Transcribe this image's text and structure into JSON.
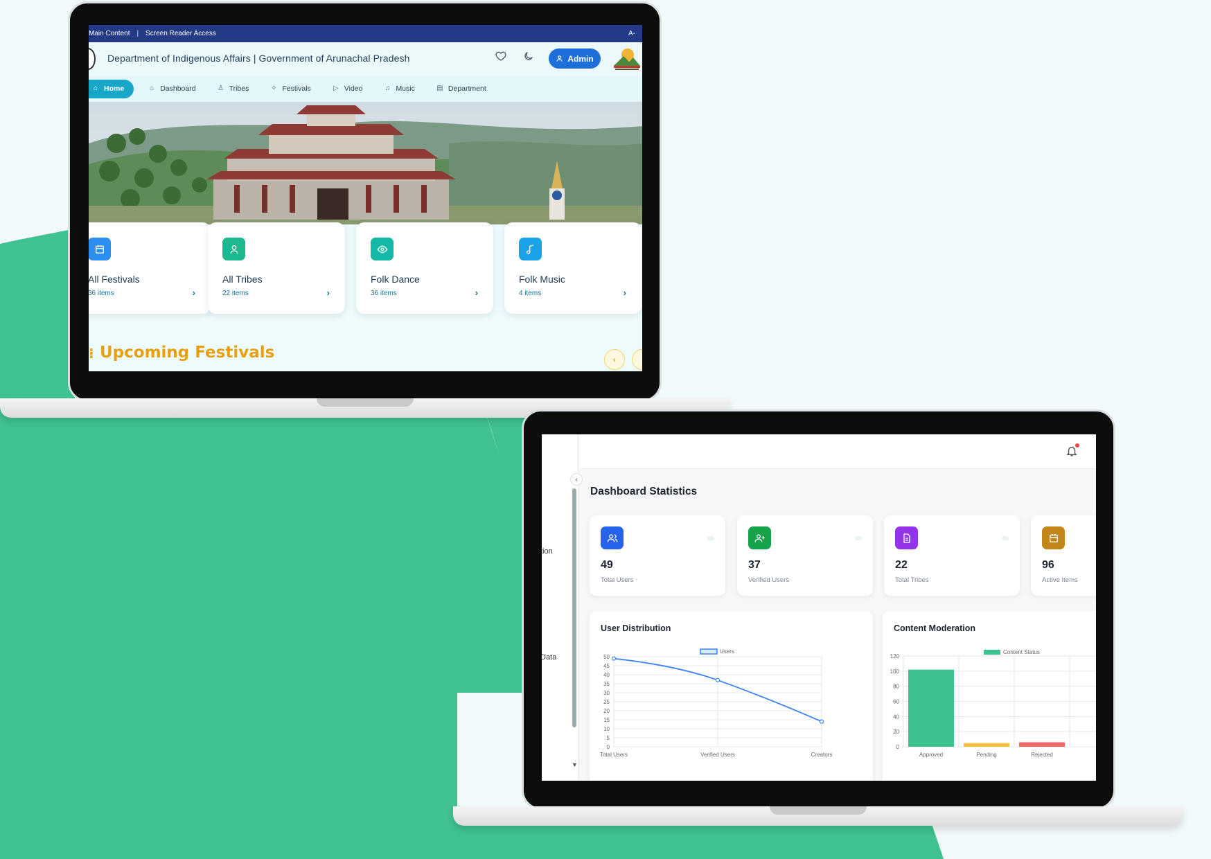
{
  "colors": {
    "background": "#f1f9fb",
    "green_shape": "#3fc191",
    "portal_topbar": "#233a86",
    "portal_accent": "#18a7c9",
    "admin_button": "#1e6fd9",
    "upcoming_title": "#e8a012",
    "line_series": "#3b82f6",
    "bar_approved": "#3cc18f",
    "bar_pending": "#f5c242",
    "bar_rejected": "#f06a6a"
  },
  "portal": {
    "topbar": {
      "main_content": "Main Content",
      "separator": "|",
      "screen_reader": "Screen Reader Access",
      "font_size": "A-"
    },
    "header": {
      "title": "Department of Indigenous Affairs | Government of Arunachal Pradesh",
      "admin_label": "Admin"
    },
    "nav": [
      {
        "label": "Home",
        "icon": "home-icon",
        "active": true
      },
      {
        "label": "Dashboard",
        "icon": "dashboard-icon"
      },
      {
        "label": "Tribes",
        "icon": "user-icon"
      },
      {
        "label": "Festivals",
        "icon": "sparkle-icon"
      },
      {
        "label": "Video",
        "icon": "play-icon"
      },
      {
        "label": "Music",
        "icon": "music-note-icon"
      },
      {
        "label": "Department",
        "icon": "building-icon"
      }
    ],
    "cards": [
      {
        "title": "All Festivals",
        "count": "36 items",
        "icon": "calendar-icon",
        "color": "#2b8ef0"
      },
      {
        "title": "All Tribes",
        "count": "22 items",
        "icon": "user-icon",
        "color": "#1cb88f"
      },
      {
        "title": "Folk Dance",
        "count": "36 items",
        "icon": "eye-icon",
        "color": "#14b8a6"
      },
      {
        "title": "Folk Music",
        "count": "4 items",
        "icon": "music-note-icon",
        "color": "#1aa3e8"
      }
    ],
    "upcoming_title": "Upcoming Festivals"
  },
  "dashboard": {
    "heading": "Dashboard Statistics",
    "sidebar_fragments": [
      "tion",
      "Data"
    ],
    "stats": [
      {
        "value": "49",
        "label": "Total Users",
        "icon": "users-icon",
        "color": "#2563eb"
      },
      {
        "value": "37",
        "label": "Verified Users",
        "icon": "user-plus-icon",
        "color": "#16a34a"
      },
      {
        "value": "22",
        "label": "Total Tribes",
        "icon": "document-icon",
        "color": "#9333ea"
      },
      {
        "value": "96",
        "label": "Active Items",
        "icon": "calendar-icon",
        "color": "#c2851a"
      }
    ],
    "user_distribution_title": "User Distribution",
    "content_moderation_title": "Content Moderation"
  },
  "chart_data": [
    {
      "type": "line",
      "title": "User Distribution",
      "categories": [
        "Total Users",
        "Verified Users",
        "Creators"
      ],
      "series": [
        {
          "name": "Users",
          "values": [
            49,
            37,
            14
          ]
        }
      ],
      "yticks": [
        "0",
        "5",
        "10",
        "15",
        "20",
        "25",
        "30",
        "35",
        "40",
        "45",
        "50"
      ],
      "ylim": [
        0,
        50
      ],
      "grid": true,
      "legend": "top"
    },
    {
      "type": "bar",
      "title": "Content Moderation",
      "categories": [
        "Approved",
        "Pending",
        "Rejected"
      ],
      "series": [
        {
          "name": "Content Status",
          "values": [
            102,
            5,
            6
          ]
        }
      ],
      "yticks": [
        "0",
        "20",
        "40",
        "60",
        "80",
        "100",
        "120"
      ],
      "ylim": [
        0,
        120
      ],
      "grid": true,
      "legend": "top"
    }
  ]
}
